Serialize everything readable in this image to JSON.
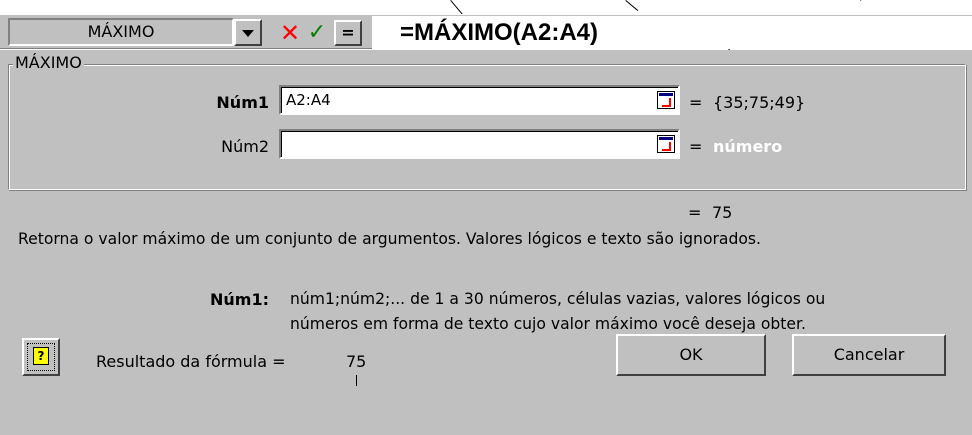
{
  "formula_bar": {
    "name_box": "MÁXIMO",
    "cancel_symbol": "✕",
    "enter_symbol": "✓",
    "edit_symbol": "=",
    "formula": "=MÁXIMO(A2:A4)"
  },
  "dialog": {
    "group_title": "MÁXIMO",
    "args": [
      {
        "label": "Núm1",
        "value": "A2:A4",
        "equals": "=",
        "result": "{35;75;49}"
      },
      {
        "label": "Núm2",
        "value": "",
        "equals": "=",
        "result": "número"
      }
    ],
    "total_equals": "=",
    "total_value": "75",
    "description": "Retorna o valor máximo de um conjunto de argumentos. Valores lógicos e texto são ignorados.",
    "arg_help_label": "Núm1:",
    "arg_help_line1": "núm1;núm2;... de 1 a 30 números, células vazias, valores lógicos ou",
    "arg_help_line2": "números em forma de texto cujo valor máximo você deseja obter.",
    "result_label": "Resultado da fórmula =",
    "result_value": "75",
    "ok_label": "OK",
    "cancel_label": "Cancelar"
  },
  "icons": {
    "help": "question-icon",
    "collapse": "collapse-dialog-icon",
    "dropdown": "chevron-down-icon"
  }
}
